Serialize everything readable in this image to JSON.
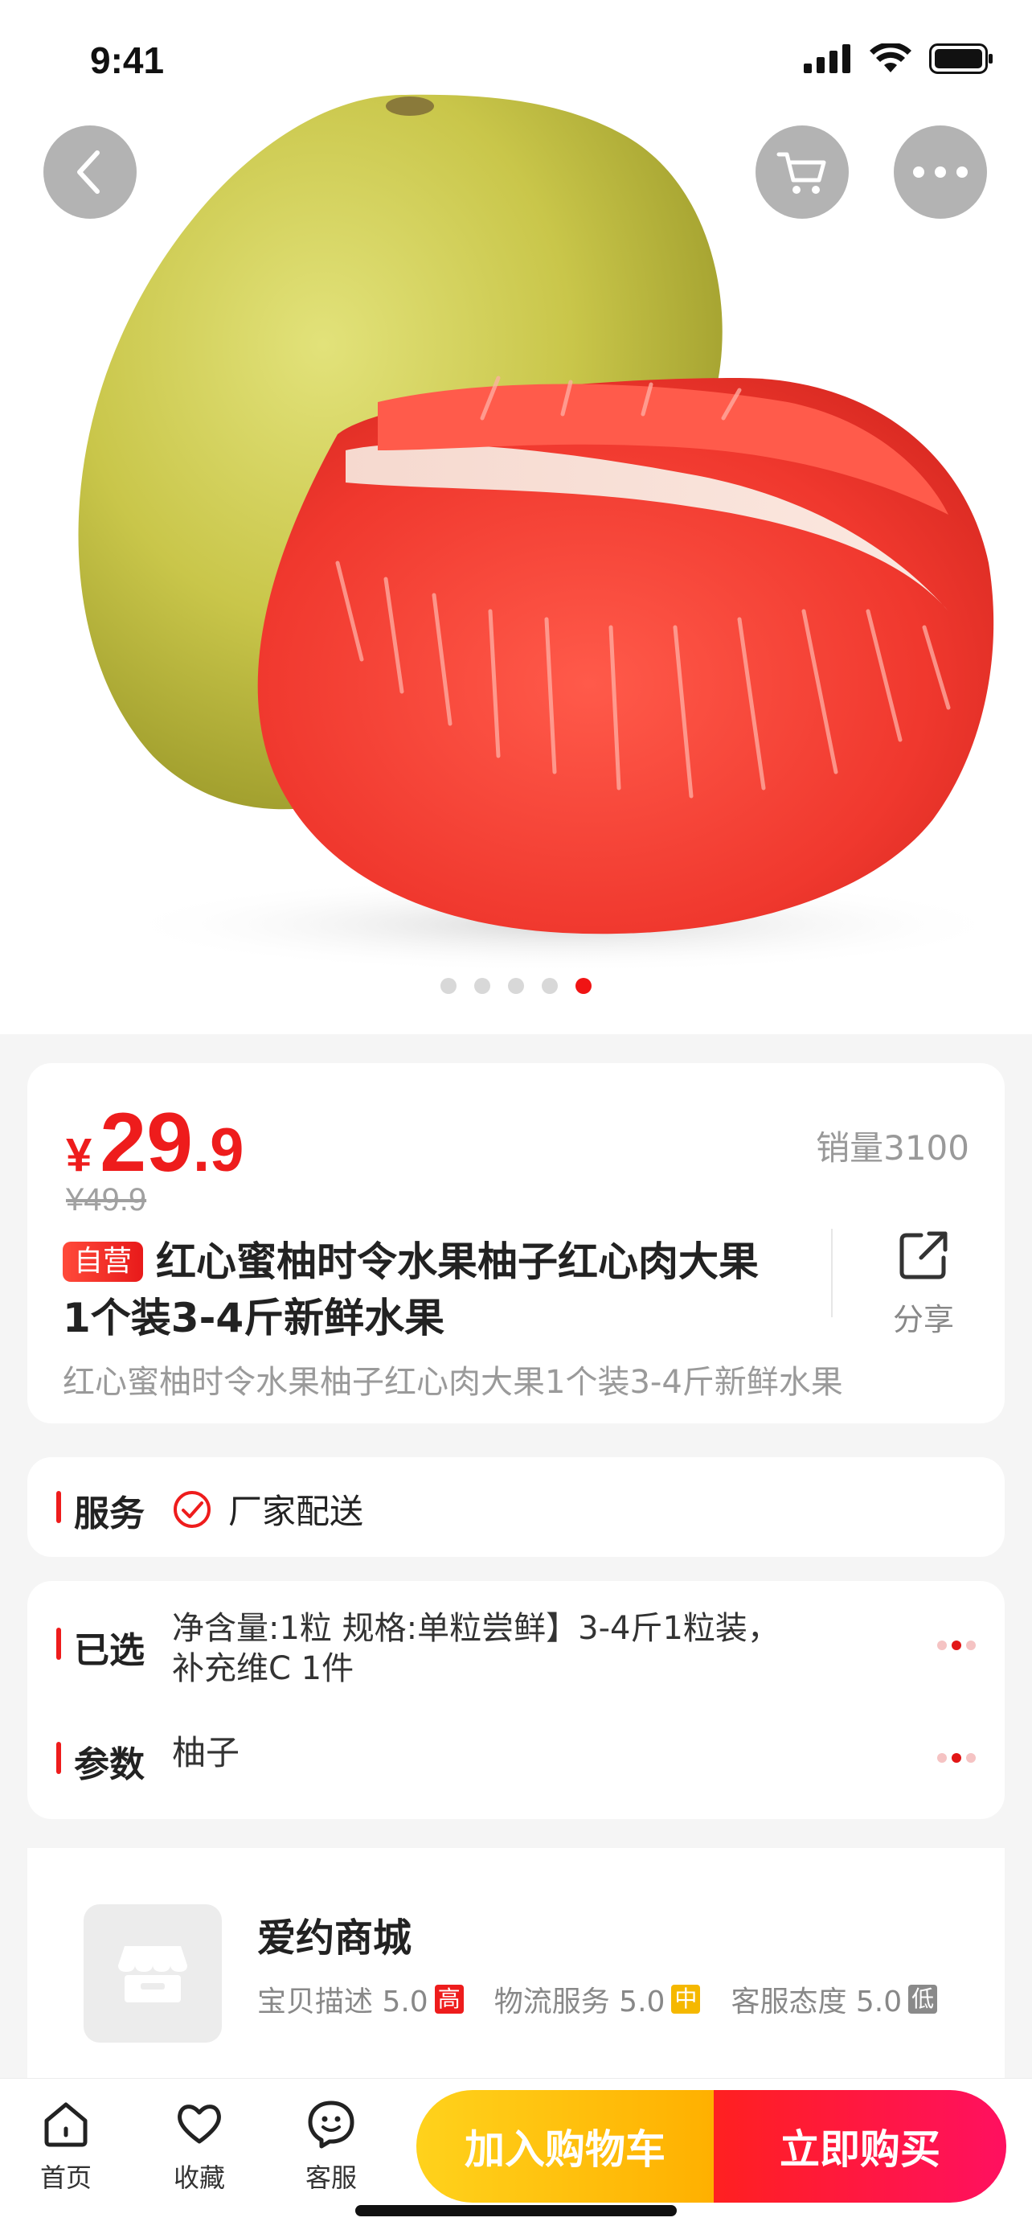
{
  "status_bar": {
    "time": "9:41"
  },
  "hero": {
    "image_subject": "red-pomelo-photo",
    "carousel": {
      "count": 5,
      "active_index": 5
    }
  },
  "product": {
    "price_symbol": "¥",
    "price_integer": "29",
    "price_decimal": ".9",
    "original_price": "¥49.9",
    "sales": "销量3100",
    "tag": "自营",
    "title": "红心蜜柚时令水果柚子红心肉大果1个装3-4斤新鲜水果",
    "subtitle": "红心蜜柚时令水果柚子红心肉大果1个装3-4斤新鲜水果",
    "share_label": "分享"
  },
  "service": {
    "label": "服务",
    "value": "厂家配送"
  },
  "selection": {
    "label": "已选",
    "value": "净含量:1粒  规格:单粒尝鲜】3-4斤1粒装，补充维C    1件",
    "params_label": "参数",
    "params_value": "柚子"
  },
  "shop": {
    "name": "爱约商城",
    "scores": [
      {
        "label": "宝贝描述 5.0",
        "level": "高"
      },
      {
        "label": "物流服务 5.0",
        "level": "中"
      },
      {
        "label": "客服态度 5.0",
        "level": "低"
      }
    ]
  },
  "bottom_nav": {
    "home": "首页",
    "favorite": "收藏",
    "service": "客服",
    "add_to_cart": "加入购物车",
    "buy_now": "立即购买"
  },
  "colors": {
    "accent_red": "#ee1c1c",
    "cart_yellow": "#ffc107",
    "buy_red": "#ff1a40"
  }
}
